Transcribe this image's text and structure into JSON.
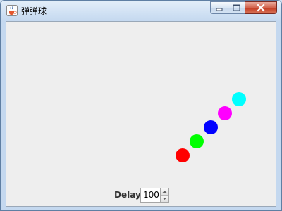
{
  "window": {
    "title": "弹弹球",
    "title_icon": "java-cup-icon",
    "buttons": [
      {
        "name": "minimize",
        "icon": "minimize-icon"
      },
      {
        "name": "maximize",
        "icon": "maximize-icon"
      },
      {
        "name": "close",
        "icon": "close-icon"
      }
    ]
  },
  "balls": [
    {
      "color": "#ff0000"
    },
    {
      "color": "#00ff00"
    },
    {
      "color": "#0000ff"
    },
    {
      "color": "#ff00ff"
    },
    {
      "color": "#00ffff"
    }
  ],
  "controls": {
    "delay_label": "Delay",
    "delay_value": "100"
  }
}
